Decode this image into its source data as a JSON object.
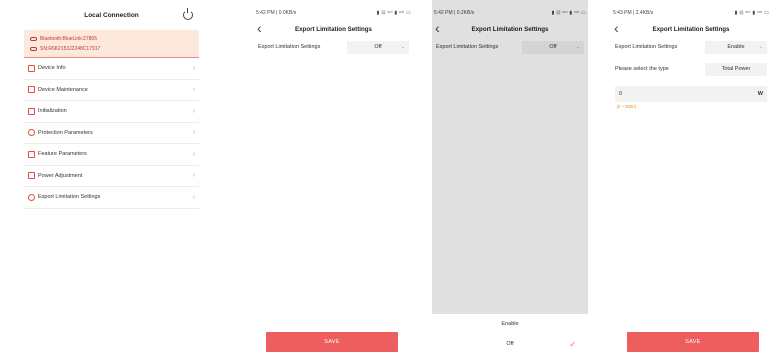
{
  "panel1": {
    "title": "Local Connection",
    "bluetooth": "Bluetooth:BlueLink:27805",
    "sn": "SN:R6K2153J2248C17917",
    "menu": [
      {
        "label": "Device Info"
      },
      {
        "label": "Device Maintenance"
      },
      {
        "label": "Initialization"
      },
      {
        "label": "Protection Parameters"
      },
      {
        "label": "Feature Parameters"
      },
      {
        "label": "Power Adjustment"
      },
      {
        "label": "Export Limitation Settings"
      }
    ]
  },
  "panel2": {
    "status_left": "5:42 PM | 0.0KB/s",
    "status_right": "▮ ⊡ ᵛᵒˡ ▮ ᵛᵒˡ ▭",
    "title": "Export Limitation Settings",
    "row_label": "Export Limitation Settings",
    "row_value": "Off",
    "save": "SAVE"
  },
  "panel3": {
    "status_left": "5:42 PM | 0.2KB/s",
    "status_right": "▮ ⊡ ᵛᵒˡ ▮ ᵛᵒˡ ▭",
    "title": "Export Limitation Settings",
    "row_label": "Export Limitation Settings",
    "row_value": "Off",
    "options": [
      "Enable",
      "Off"
    ]
  },
  "panel4": {
    "status_left": "5:43 PM | 2.4KB/s",
    "status_right": "▮ ⊡ ᵛᵒˡ ▮ ᵛᵒˡ ▭",
    "title": "Export Limitation Settings",
    "row_label": "Export Limitation Settings",
    "row_value": "Enable",
    "type_label": "Please select the type",
    "type_value": "Total Power",
    "input_value": "0",
    "input_unit": "W",
    "hint": "[0 ~ 5000]",
    "save": "SAVE"
  },
  "colors": {
    "accent": "#ee5e5e",
    "banner_bg": "#fde8de",
    "banner_text": "#c2382d",
    "hint": "#e8922d"
  }
}
